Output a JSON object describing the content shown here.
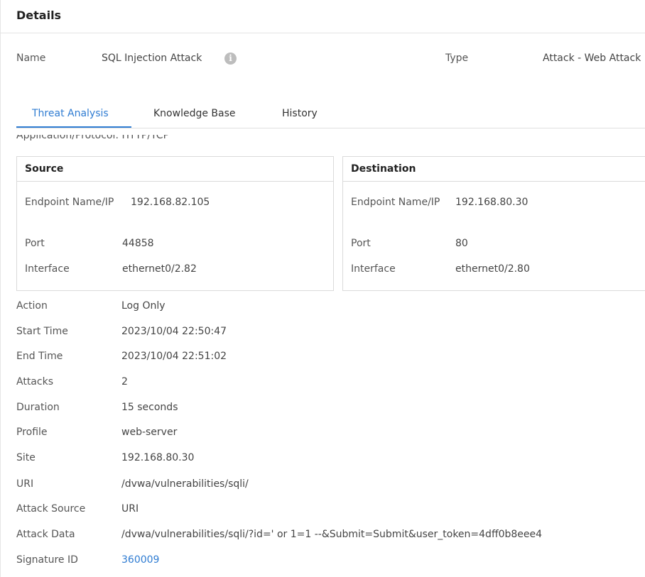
{
  "header": {
    "title": "Details"
  },
  "summary": {
    "name_label": "Name",
    "name_value": "SQL Injection Attack",
    "info_icon": "i",
    "type_label": "Type",
    "type_value": "Attack - Web Attack"
  },
  "tabs": [
    {
      "label": "Threat Analysis",
      "active": true
    },
    {
      "label": "Knowledge Base",
      "active": false
    },
    {
      "label": "History",
      "active": false
    }
  ],
  "application_protocol": "Application/Protocol: HTTP/TCP",
  "source": {
    "title": "Source",
    "endpoint_label": "Endpoint Name/IP",
    "endpoint_value": "192.168.82.105",
    "port_label": "Port",
    "port_value": "44858",
    "interface_label": "Interface",
    "interface_value": "ethernet0/2.82"
  },
  "destination": {
    "title": "Destination",
    "endpoint_label": "Endpoint Name/IP",
    "endpoint_value": "192.168.80.30",
    "port_label": "Port",
    "port_value": "80",
    "interface_label": "Interface",
    "interface_value": "ethernet0/2.80"
  },
  "details": {
    "action_label": "Action",
    "action_value": "Log Only",
    "start_label": "Start Time",
    "start_value": "2023/10/04 22:50:47",
    "end_label": "End Time",
    "end_value": "2023/10/04 22:51:02",
    "attacks_label": "Attacks",
    "attacks_value": "2",
    "duration_label": "Duration",
    "duration_value": "15 seconds",
    "profile_label": "Profile",
    "profile_value": "web-server",
    "site_label": "Site",
    "site_value": "192.168.80.30",
    "uri_label": "URI",
    "uri_value": "/dvwa/vulnerabilities/sqli/",
    "attack_source_label": "Attack Source",
    "attack_source_value": "URI",
    "attack_data_label": "Attack Data",
    "attack_data_value": "/dvwa/vulnerabilities/sqli/?id=' or 1=1 --&Submit=Submit&user_token=4dff0b8eee4",
    "signature_label": "Signature ID",
    "signature_value": "360009"
  },
  "colors": {
    "accent": "#2f7cd2",
    "border": "#dadada",
    "text": "#333333"
  }
}
